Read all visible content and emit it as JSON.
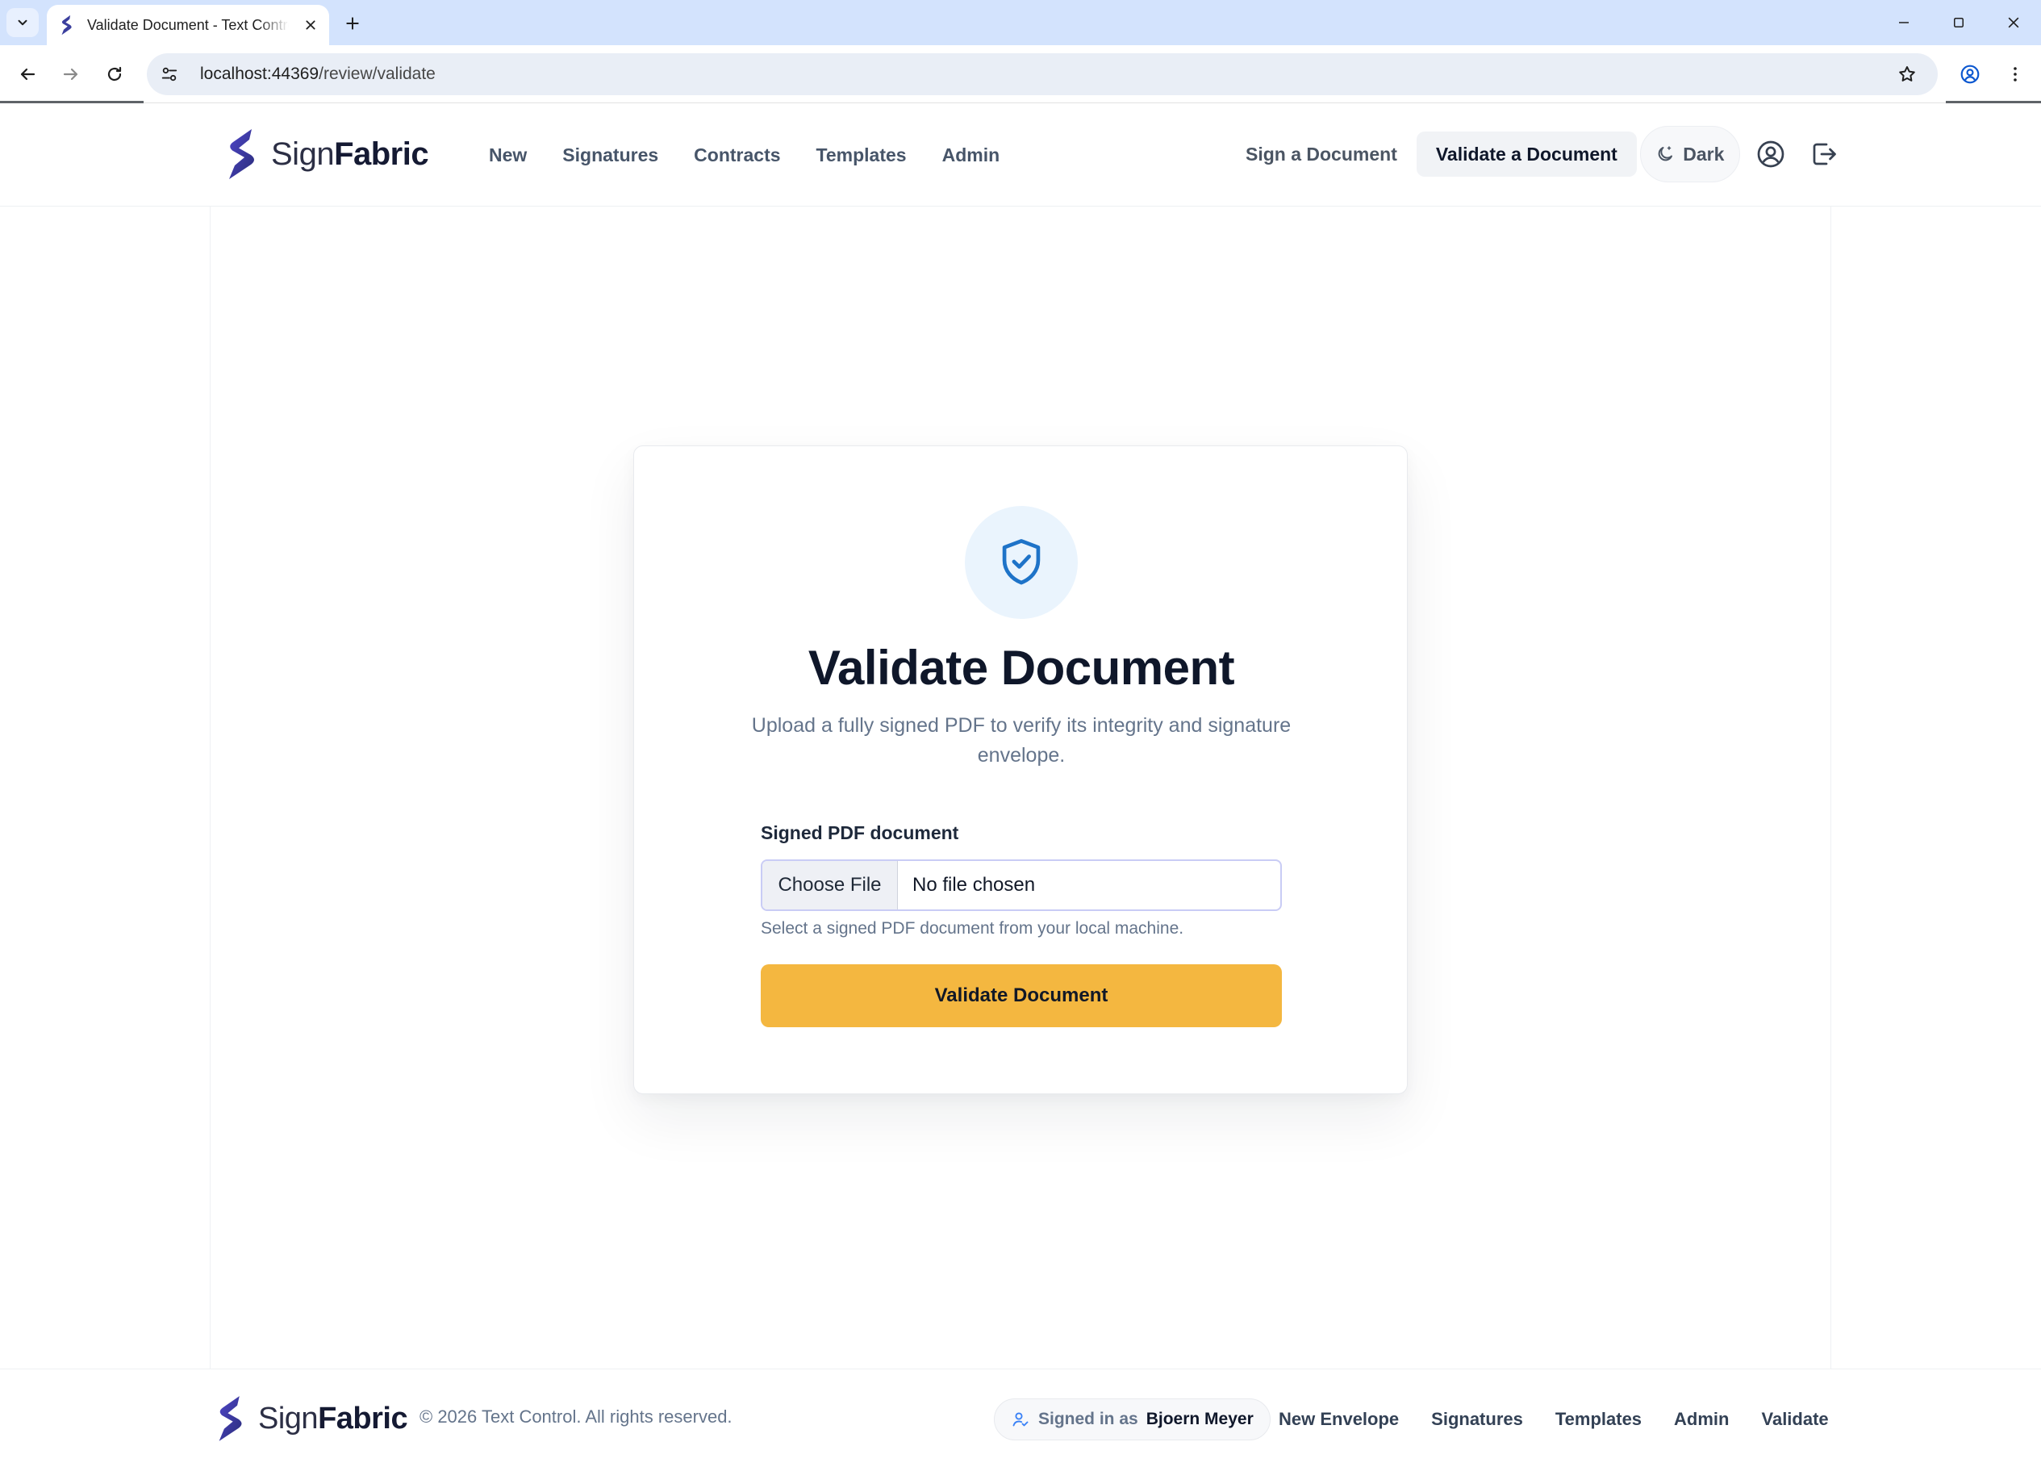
{
  "browser": {
    "tab_title": "Validate Document - Text Control",
    "url_host": "localhost:44369",
    "url_path": "/review/validate"
  },
  "header": {
    "logo_sign": "Sign",
    "logo_fabric": "Fabric",
    "nav": [
      {
        "label": "New"
      },
      {
        "label": "Signatures"
      },
      {
        "label": "Contracts"
      },
      {
        "label": "Templates"
      },
      {
        "label": "Admin"
      }
    ],
    "sign_document": "Sign a Document",
    "validate_document": "Validate a Document",
    "theme_toggle": "Dark"
  },
  "card": {
    "title": "Validate Document",
    "subtitle": "Upload a fully signed PDF to verify its integrity and signature envelope.",
    "field_label": "Signed PDF document",
    "choose_file": "Choose File",
    "no_file": "No file chosen",
    "help": "Select a signed PDF document from your local machine.",
    "submit": "Validate Document"
  },
  "footer": {
    "logo_sign": "Sign",
    "logo_fabric": "Fabric",
    "copyright": "© 2026 Text Control. All rights reserved.",
    "signed_in_prefix": "Signed in as",
    "user_name": "Bjoern Meyer",
    "nav": [
      {
        "label": "New Envelope"
      },
      {
        "label": "Signatures"
      },
      {
        "label": "Templates"
      },
      {
        "label": "Admin"
      },
      {
        "label": "Validate"
      }
    ]
  },
  "colors": {
    "brand_dark": "#151a33",
    "accent_button": "#f4b740",
    "shield_blue": "#1e73c8",
    "shield_bg": "#eaf4fd"
  },
  "icons": {
    "tab_list": "chevron-down-icon",
    "close_tab": "close-icon",
    "new_tab": "plus-icon",
    "back": "arrow-left-icon",
    "forward": "arrow-right-icon",
    "reload": "reload-icon",
    "site_info": "tune-icon",
    "bookmark": "star-icon",
    "profile": "profile-icon",
    "menu": "kebab-icon",
    "theme": "moon-icon",
    "account": "user-circle-icon",
    "logout": "logout-icon",
    "validate": "shield-check-icon",
    "signed_user": "user-check-icon"
  }
}
